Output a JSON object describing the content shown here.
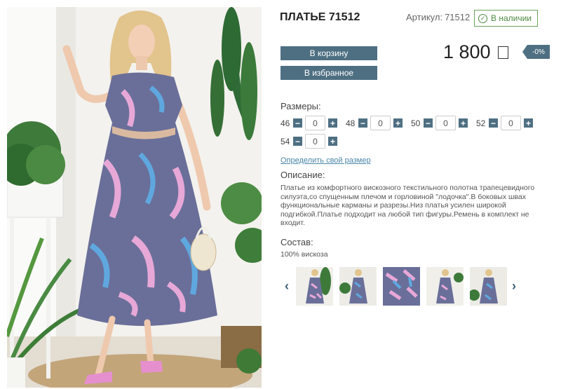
{
  "product": {
    "title": "ПЛАТЬЕ 71512",
    "article_label": "Артикул:",
    "article_value": "71512",
    "stock_label": "В наличии",
    "price": "1 800",
    "discount": "-0%"
  },
  "actions": {
    "cart_label": "В корзину",
    "favorite_label": "В избранное"
  },
  "sizes": {
    "label": "Размеры:",
    "items": [
      {
        "size": "46",
        "qty": "0"
      },
      {
        "size": "48",
        "qty": "0"
      },
      {
        "size": "50",
        "qty": "0"
      },
      {
        "size": "52",
        "qty": "0"
      },
      {
        "size": "54",
        "qty": "0"
      }
    ],
    "minus_symbol": "−",
    "plus_symbol": "+"
  },
  "size_link": "Определить свой размер",
  "description": {
    "label": "Описание:",
    "text": "Платье из комфортного вискозного текстильного полотна трапецевидного силуэта,со спущенным плечом и горловиной \"лодочка\".В боковых швах функциональные карманы и разрезы.Низ платья усилен широкой подгибкой.Платье подходит на любой тип фигуры.Ремень в комплект не входит."
  },
  "composition": {
    "label": "Состав:",
    "text": "100% вискоза"
  },
  "gallery": {
    "prev": "‹",
    "next": "›"
  },
  "colors": {
    "accent": "#4e6f82",
    "stock_green": "#4f8a40",
    "link": "#4a86a8",
    "dress_base": "#6a6f99",
    "dress_pink": "#e7a8d8",
    "dress_blue": "#5fa8df"
  }
}
